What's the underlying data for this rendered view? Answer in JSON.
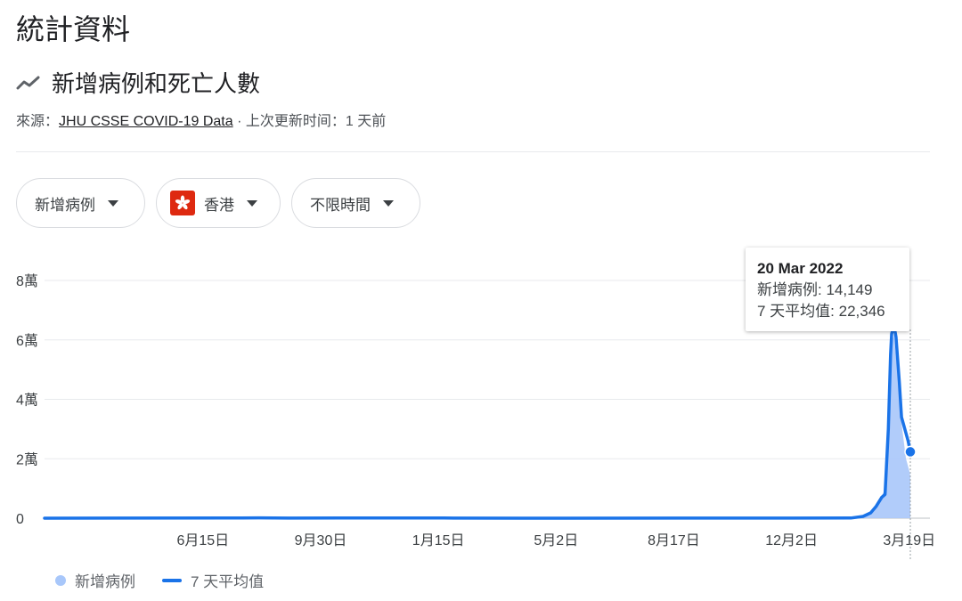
{
  "page": {
    "title": "統計資料",
    "subtitle": "新增病例和死亡人數",
    "source_prefix": "來源：",
    "source_link": "JHU CSSE COVID-19 Data",
    "source_suffix": " · 上次更新时间：1 天前"
  },
  "filters": {
    "metric": "新增病例",
    "region": "香港",
    "period": "不限時間"
  },
  "tooltip": {
    "date": "20 Mar 2022",
    "cases_label": "新增病例: 14,149",
    "avg_label": "7 天平均值: 22,346"
  },
  "legend": {
    "cases": "新增病例",
    "avg": "7 天平均值"
  },
  "colors": {
    "line": "#1a73e8",
    "area": "#a8c7fa",
    "grid": "#e8eaed",
    "flag": "#de2910"
  },
  "chart_data": {
    "type": "line",
    "y_ticks": [
      "0",
      "2萬",
      "4萬",
      "6萬",
      "8萬"
    ],
    "y_tick_values": [
      0,
      20000,
      40000,
      60000,
      80000
    ],
    "ylim": [
      0,
      80000
    ],
    "x_ticks": [
      "6月15日",
      "9月30日",
      "1月15日",
      "5月2日",
      "8月17日",
      "12月2日",
      "3月19日"
    ],
    "x_tick_dates": [
      "2020-06-15",
      "2020-09-30",
      "2021-01-15",
      "2021-05-02",
      "2021-08-17",
      "2021-12-02",
      "2022-03-19"
    ],
    "x_range": [
      "2020-01-23",
      "2022-03-20"
    ],
    "series": [
      {
        "name": "7 天平均值",
        "points": [
          [
            "2020-01-23",
            0
          ],
          [
            "2020-07-20",
            100
          ],
          [
            "2020-08-05",
            120
          ],
          [
            "2020-09-01",
            30
          ],
          [
            "2020-12-05",
            100
          ],
          [
            "2021-01-20",
            60
          ],
          [
            "2021-04-01",
            10
          ],
          [
            "2022-01-25",
            60
          ],
          [
            "2022-02-05",
            600
          ],
          [
            "2022-02-12",
            1800
          ],
          [
            "2022-02-17",
            4000
          ],
          [
            "2022-02-22",
            7000
          ],
          [
            "2022-02-25",
            8000
          ],
          [
            "2022-02-28",
            30000
          ],
          [
            "2022-03-02",
            55000
          ],
          [
            "2022-03-03",
            62000
          ],
          [
            "2022-03-05",
            65000
          ],
          [
            "2022-03-07",
            61000
          ],
          [
            "2022-03-10",
            46000
          ],
          [
            "2022-03-12",
            34000
          ],
          [
            "2022-03-15",
            30000
          ],
          [
            "2022-03-18",
            26000
          ],
          [
            "2022-03-20",
            22346
          ]
        ]
      },
      {
        "name": "新增病例",
        "points": [
          [
            "2020-01-23",
            0
          ],
          [
            "2022-01-25",
            100
          ],
          [
            "2022-02-10",
            1500
          ],
          [
            "2022-02-17",
            4000
          ],
          [
            "2022-02-24",
            9000
          ],
          [
            "2022-02-27",
            25000
          ],
          [
            "2022-03-01",
            46000
          ],
          [
            "2022-03-03",
            58000
          ],
          [
            "2022-03-05",
            62000
          ],
          [
            "2022-03-08",
            50000
          ],
          [
            "2022-03-12",
            32000
          ],
          [
            "2022-03-16",
            20000
          ],
          [
            "2022-03-19",
            16000
          ],
          [
            "2022-03-20",
            14149
          ]
        ]
      }
    ],
    "highlight": {
      "date": "2022-03-20",
      "value": 22346
    },
    "legend_position": "bottom-left",
    "grid": true
  }
}
